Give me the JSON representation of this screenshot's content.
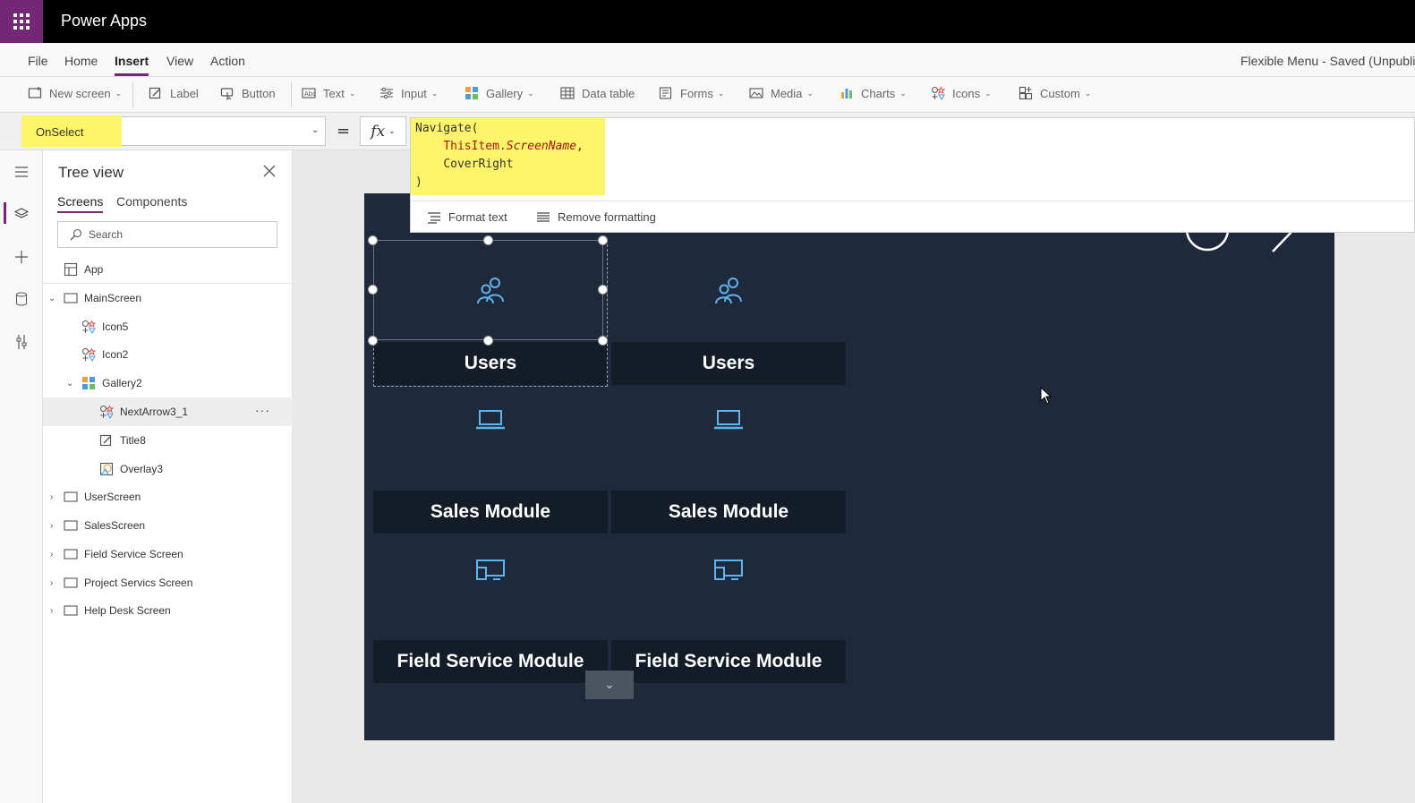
{
  "app": {
    "title": "Power Apps"
  },
  "menu": {
    "items": [
      "File",
      "Home",
      "Insert",
      "View",
      "Action"
    ],
    "active": "Insert",
    "doc_status": "Flexible Menu - Saved (Unpublis"
  },
  "toolbar": {
    "new_screen": "New screen",
    "label": "Label",
    "button": "Button",
    "text": "Text",
    "input": "Input",
    "gallery": "Gallery",
    "data_table": "Data table",
    "forms": "Forms",
    "media": "Media",
    "charts": "Charts",
    "icons": "Icons",
    "custom": "Custom"
  },
  "formula": {
    "property": "OnSelect",
    "equals": "=",
    "fx": "fx",
    "code_line1": "Navigate(",
    "code_line2_obj": "ThisItem.",
    "code_line2_prop": "ScreenName",
    "code_line2_end": ",",
    "code_line3": "CoverRight",
    "code_line4": ")",
    "format_text": "Format text",
    "remove_formatting": "Remove formatting"
  },
  "tree": {
    "title": "Tree view",
    "tabs": [
      "Screens",
      "Components"
    ],
    "search_placeholder": "Search",
    "items": [
      {
        "label": "App"
      },
      {
        "label": "MainScreen"
      },
      {
        "label": "Icon5"
      },
      {
        "label": "Icon2"
      },
      {
        "label": "Gallery2"
      },
      {
        "label": "NextArrow3_1",
        "more": "···"
      },
      {
        "label": "Title8"
      },
      {
        "label": "Overlay3"
      },
      {
        "label": "UserScreen"
      },
      {
        "label": "SalesScreen"
      },
      {
        "label": "Field Service Screen"
      },
      {
        "label": "Project Servics Screen"
      },
      {
        "label": "Help Desk Screen"
      }
    ]
  },
  "gallery": {
    "cards": [
      {
        "title": "Users",
        "icon": "users-icon"
      },
      {
        "title": "Users",
        "icon": "users-icon"
      },
      {
        "title": "Sales Module",
        "icon": "laptop-icon"
      },
      {
        "title": "Sales Module",
        "icon": "laptop-icon"
      },
      {
        "title": "Field Service Module",
        "icon": "devices-icon"
      },
      {
        "title": "Field Service Module",
        "icon": "devices-icon"
      }
    ]
  },
  "colors": {
    "brand": "#742774",
    "highlight": "#fff56a",
    "canvas": "#1e2a3b",
    "card_title": "#141c27",
    "icon_blue": "#5fb4f0"
  }
}
